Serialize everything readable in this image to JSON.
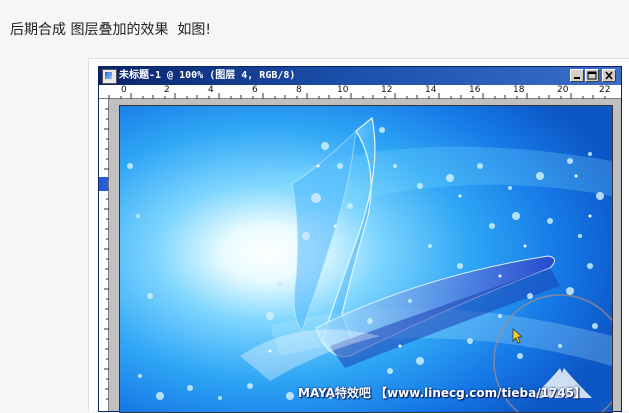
{
  "caption": "后期合成 图层叠加的效果  如图!",
  "window": {
    "title": "未标题-1 @ 100% (图层 4, RGB/8)",
    "buttons": {
      "minimize": "minimize",
      "maximize": "maximize",
      "close": "close"
    }
  },
  "ruler": {
    "ticks": [
      "0",
      "2",
      "4",
      "6",
      "8",
      "10",
      "12",
      "14",
      "16",
      "18",
      "20",
      "22"
    ]
  },
  "artwork": {
    "watermark": "MAYA特效吧 【www.linecg.com/tieba/1745】"
  },
  "colors": {
    "titlebar": "#0a246a",
    "artwork_base": "#1f8ff0",
    "highlight": "#e9fbff"
  }
}
